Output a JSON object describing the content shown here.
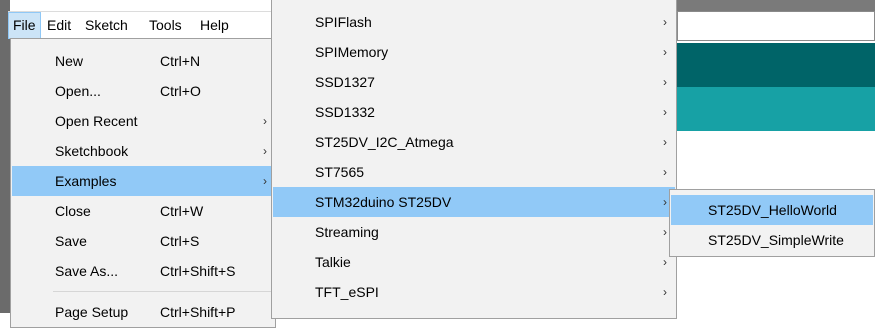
{
  "colors": {
    "app_dark": "#006468",
    "app_teal": "#17a1a5",
    "highlight": "#91c9f7"
  },
  "menubar": {
    "items": [
      "File",
      "Edit",
      "Sketch",
      "Tools",
      "Help"
    ]
  },
  "file_menu": {
    "items": [
      {
        "label": "New",
        "shortcut": "Ctrl+N"
      },
      {
        "label": "Open...",
        "shortcut": "Ctrl+O"
      },
      {
        "label": "Open Recent",
        "shortcut": ""
      },
      {
        "label": "Sketchbook",
        "shortcut": ""
      },
      {
        "label": "Examples",
        "shortcut": ""
      },
      {
        "label": "Close",
        "shortcut": "Ctrl+W"
      },
      {
        "label": "Save",
        "shortcut": "Ctrl+S"
      },
      {
        "label": "Save As...",
        "shortcut": "Ctrl+Shift+S"
      },
      {
        "label": "Page Setup",
        "shortcut": "Ctrl+Shift+P"
      }
    ]
  },
  "examples_menu": {
    "items": [
      "SPIFlash",
      "SPIMemory",
      "SSD1327",
      "SSD1332",
      "ST25DV_I2C_Atmega",
      "ST7565",
      "STM32duino ST25DV",
      "Streaming",
      "Talkie",
      "TFT_eSPI"
    ]
  },
  "st25dv_menu": {
    "items": [
      "ST25DV_HelloWorld",
      "ST25DV_SimpleWrite"
    ]
  },
  "icons": {
    "submenu_arrow": "chevron-right-icon"
  }
}
